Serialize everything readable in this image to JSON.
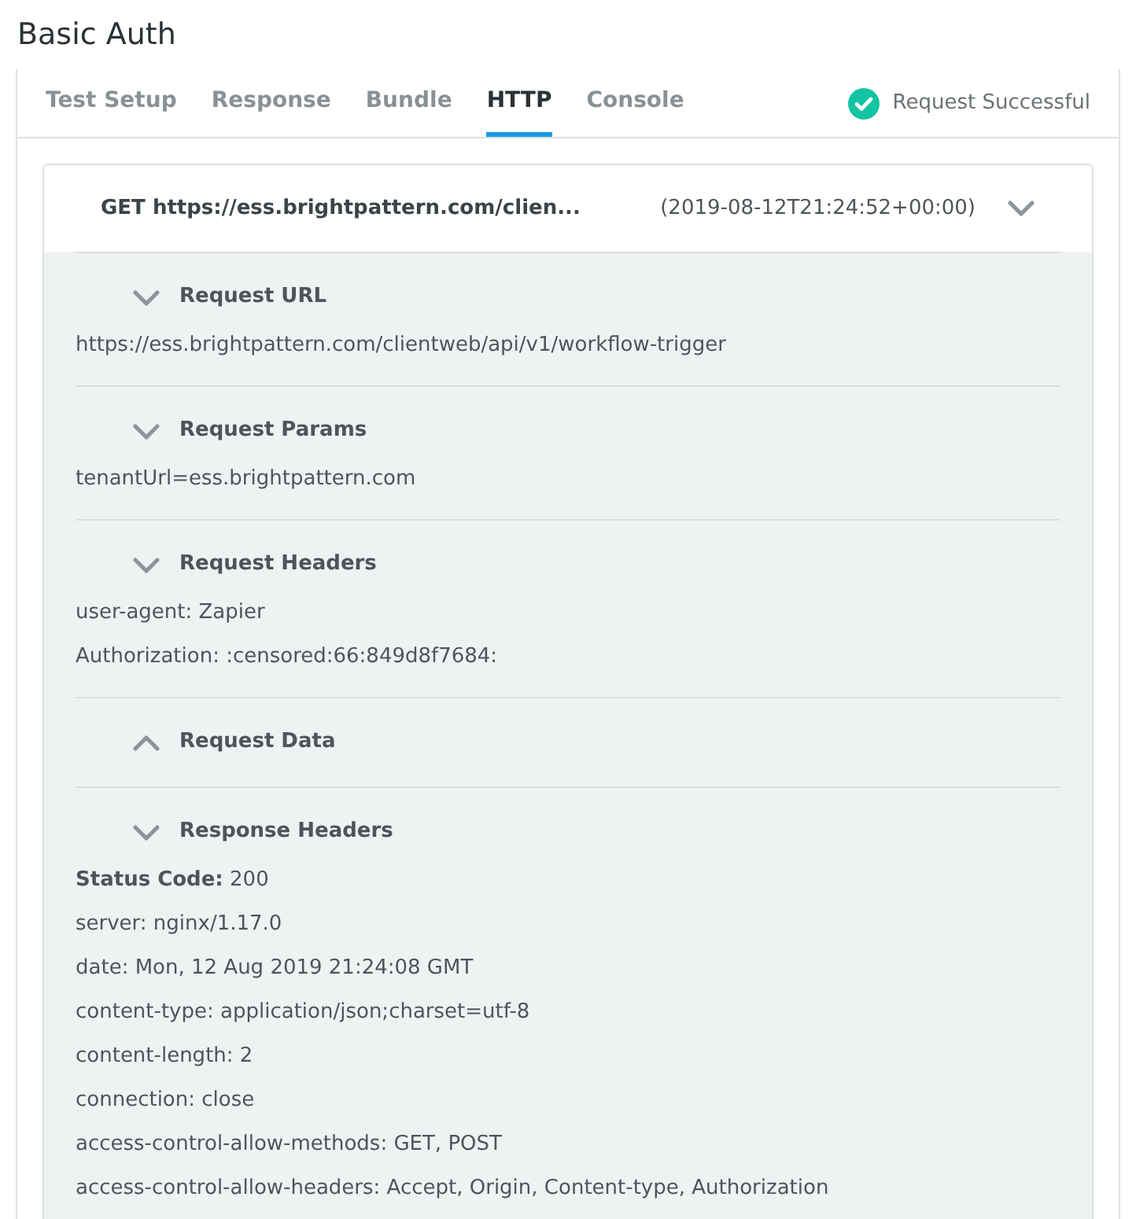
{
  "title": "Basic Auth",
  "tabs": [
    {
      "label": "Test Setup",
      "selected": false
    },
    {
      "label": "Response",
      "selected": false
    },
    {
      "label": "Bundle",
      "selected": false
    },
    {
      "label": "HTTP",
      "selected": true
    },
    {
      "label": "Console",
      "selected": false
    }
  ],
  "status": {
    "kind": "success",
    "text": "Request Successful"
  },
  "request": {
    "summary": "GET https://ess.brightpattern.com/clien...",
    "timestamp": "(2019-08-12T21:24:52+00:00)",
    "expanded": true,
    "sections": [
      {
        "title": "Request URL",
        "expanded": true,
        "lines": [
          "https://ess.brightpattern.com/clientweb/api/v1/workflow-trigger"
        ]
      },
      {
        "title": "Request Params",
        "expanded": true,
        "lines": [
          "tenantUrl=ess.brightpattern.com"
        ]
      },
      {
        "title": "Request Headers",
        "expanded": true,
        "lines": [
          "user-agent: Zapier",
          "Authorization: :censored:66:849d8f7684:"
        ]
      },
      {
        "title": "Request Data",
        "expanded": false
      },
      {
        "title": "Response Headers",
        "expanded": true,
        "lines": [
          "**Status Code:** 200",
          "server: nginx/1.17.0",
          "date: Mon, 12 Aug 2019 21:24:08 GMT",
          "content-type: application/json;charset=utf-8",
          "content-length: 2",
          "connection: close",
          "access-control-allow-methods: GET, POST",
          "access-control-allow-headers: Accept, Origin, Content-type, Authorization"
        ]
      }
    ]
  }
}
